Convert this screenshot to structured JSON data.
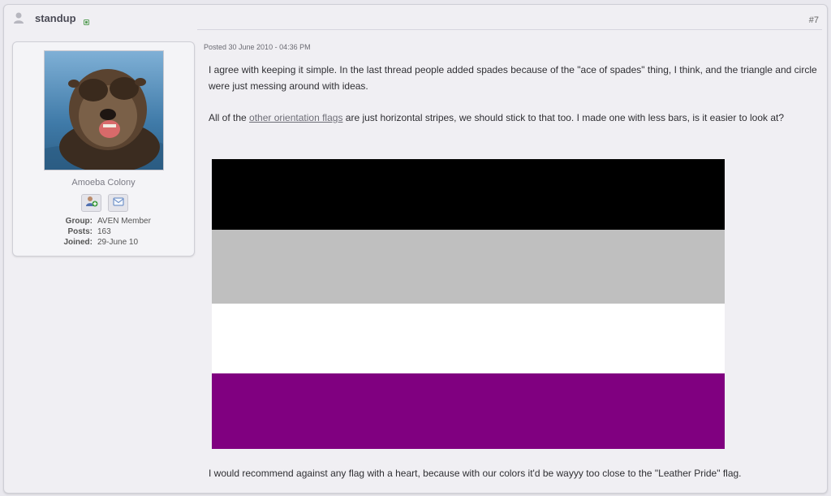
{
  "post": {
    "author": "standup",
    "number": "#7",
    "posted": "Posted 30 June 2010 - 04:36 PM"
  },
  "author_panel": {
    "member_title": "Amoeba Colony",
    "info": [
      {
        "label": "Group:",
        "value": "AVEN Member"
      },
      {
        "label": "Posts:",
        "value": "163"
      },
      {
        "label": "Joined:",
        "value": "29-June 10"
      }
    ],
    "actions": [
      {
        "icon": "add-friend-icon"
      },
      {
        "icon": "send-message-icon"
      }
    ]
  },
  "body": {
    "p1": "I agree with keeping it simple. In the last thread people added spades because of the \"ace of spades\" thing, I think, and the triangle and circle were just messing around with ideas.",
    "p2_before": "All of the ",
    "p2_link": "other orientation flags",
    "p2_after": " are just horizontal stripes, we should stick to that too. I made one with less bars, is it easier to look at?",
    "p3": "I would recommend against any flag with a heart, because with our colors it'd be wayyy too close to the \"Leather Pride\" flag."
  },
  "flag": {
    "stripes": [
      {
        "color": "#000000",
        "fraction": 0.245
      },
      {
        "color": "#bfbfbf",
        "fraction": 0.255
      },
      {
        "color": "#ffffff",
        "fraction": 0.24
      },
      {
        "color": "#800080",
        "fraction": 0.26
      }
    ]
  }
}
